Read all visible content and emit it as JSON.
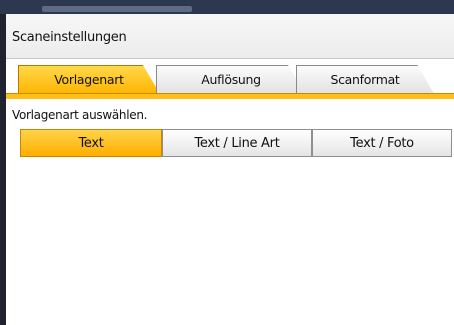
{
  "window": {
    "title": "Scaneinstellungen"
  },
  "tabs": [
    {
      "label": "Vorlagenart",
      "active": true
    },
    {
      "label": "Auflösung",
      "active": false
    },
    {
      "label": "Scanformat",
      "active": false
    }
  ],
  "main": {
    "instruction": "Vorlagenart auswählen.",
    "options": [
      {
        "label": "Text",
        "selected": true
      },
      {
        "label": "Text / Line Art",
        "selected": false
      },
      {
        "label": "Text / Foto",
        "selected": false
      }
    ]
  },
  "colors": {
    "accent": "#ffb400",
    "frame_dark": "#2b3850"
  }
}
